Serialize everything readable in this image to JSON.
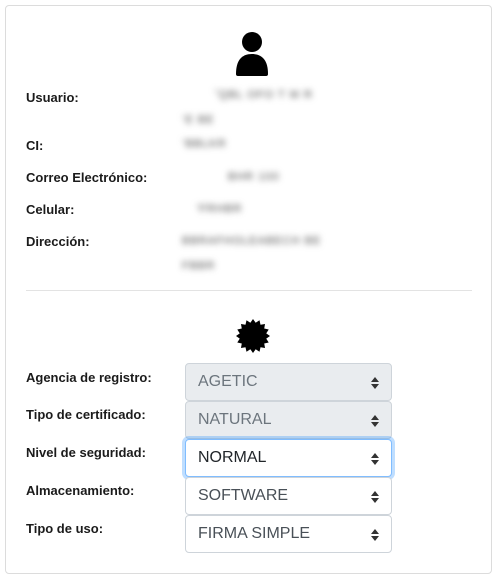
{
  "profile": {
    "fields": [
      {
        "label": "Usuario:",
        "value": "˝QBL OFO  T M       R",
        "value2": "‘E     BE"
      },
      {
        "label": "CI:",
        "value": "’BBLKR"
      },
      {
        "label": "Correo Electrónico:",
        "value": "BHR           100"
      },
      {
        "label": "Celular:",
        "value": "’FRHBR"
      },
      {
        "label": "Dirección:",
        "value": "         BBRAFHOLEABECH BE",
        "value2": "             FBBR"
      }
    ]
  },
  "certificate": {
    "fields": [
      {
        "label": "Agencia de registro:",
        "value": "AGETIC",
        "state": "disabled"
      },
      {
        "label": "Tipo de certificado:",
        "value": "NATURAL",
        "state": "disabled"
      },
      {
        "label": "Nivel de seguridad:",
        "value": "NORMAL",
        "state": "focused"
      },
      {
        "label": "Almacenamiento:",
        "value": "SOFTWARE",
        "state": "normal"
      },
      {
        "label": "Tipo de uso:",
        "value": "FIRMA SIMPLE",
        "state": "normal"
      }
    ]
  },
  "icons": {
    "profile": "user-icon",
    "certificate": "seal-icon"
  },
  "colors": {
    "focus_border": "#80bdff",
    "disabled_bg": "#e9ecef"
  }
}
